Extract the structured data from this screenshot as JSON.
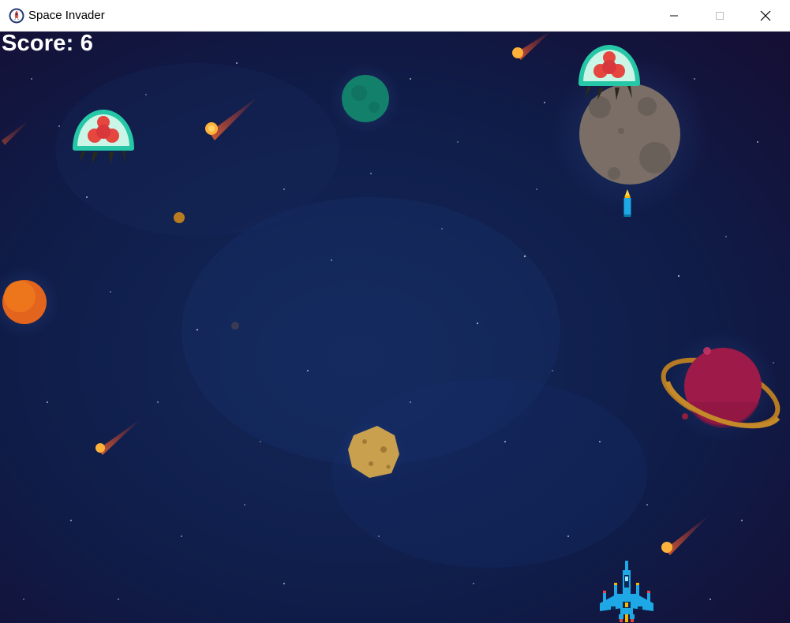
{
  "window": {
    "title": "Space Invader",
    "app_icon": "rocket-badge-icon",
    "controls": [
      "minimize-icon",
      "maximize-icon",
      "close-icon"
    ]
  },
  "hud": {
    "score_label": "Score: 6"
  },
  "colors": {
    "titlebar_bg": "#ffffff",
    "space_bg": "#0d1840",
    "score_text": "#ffffff",
    "player_ship": "#1ea8e6",
    "alien_dome": "#bdf3e0",
    "alien_core": "#e5473f"
  },
  "sprites": {
    "player": "player-spaceship",
    "enemies": [
      "alien-enemy",
      "alien-enemy"
    ],
    "projectile": "bullet"
  }
}
